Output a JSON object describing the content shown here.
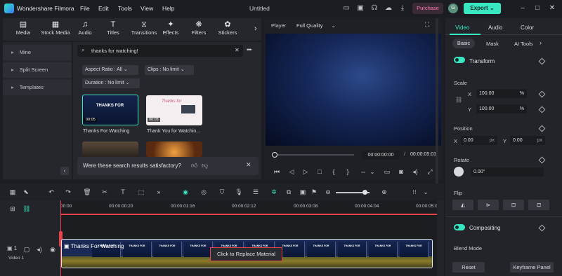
{
  "titlebar": {
    "app_name": "Wondershare Filmora",
    "menu": [
      "File",
      "Edit",
      "Tools",
      "View",
      "Help"
    ],
    "window_title": "Untitled",
    "purchase_label": "Purchase",
    "avatar_initial": "G",
    "export_label": "Export"
  },
  "media_tabs": [
    "Media",
    "Stock Media",
    "Audio",
    "Titles",
    "Transitions",
    "Effects",
    "Filters",
    "Stickers"
  ],
  "left_nav": [
    "Mine",
    "Split Screen",
    "Templates"
  ],
  "search": {
    "value": "thanks for watching!"
  },
  "filters": {
    "aspect_ratio": "Aspect Ratio : All",
    "clips": "Clips : No limit",
    "duration": "Duration : No limit"
  },
  "results": [
    {
      "label": "Thanks For Watching",
      "duration": "00:05",
      "thumb_text": "THANKS FOR"
    },
    {
      "label": "Thank You for Watchin...",
      "duration": "00:05",
      "thumb_text": "Thanks for"
    }
  ],
  "feedback_prompt": "Were these search results satisfactory?",
  "player": {
    "label": "Player",
    "quality": "Full Quality",
    "current_time": "00:00:00:00",
    "total_time": "00:00:05:01"
  },
  "right_panel": {
    "tabs": [
      "Video",
      "Audio",
      "Color"
    ],
    "subtabs": [
      "Basic",
      "Mask",
      "AI Tools"
    ],
    "transform_label": "Transform",
    "scale_label": "Scale",
    "scale_x": "100.00",
    "scale_y": "100.00",
    "scale_unit": "%",
    "position_label": "Position",
    "pos_x": "0.00",
    "pos_y": "0.00",
    "pos_unit": "px",
    "rotate_label": "Rotate",
    "rotate_value": "0.00°",
    "flip_label": "Flip",
    "compositing_label": "Compositing",
    "blend_mode_label": "Blend Mode",
    "reset_label": "Reset",
    "keyframe_label": "Keyframe Panel",
    "x_label": "X",
    "y_label": "Y"
  },
  "timeline": {
    "ticks": [
      "00:00",
      "00:00:00:20",
      "00:00:01:16",
      "00:00:02:12",
      "00:00:03:08",
      "00:00:04:04",
      "00:00:05:00"
    ],
    "clip_title": "Thanks For Watching",
    "replace_label": "Click to Replace Material",
    "track_label": "Video 1",
    "track_number": "1"
  },
  "colors": {
    "accent": "#38e6c1",
    "purchase": "#ff7ab6",
    "playhead": "#e8434a"
  }
}
